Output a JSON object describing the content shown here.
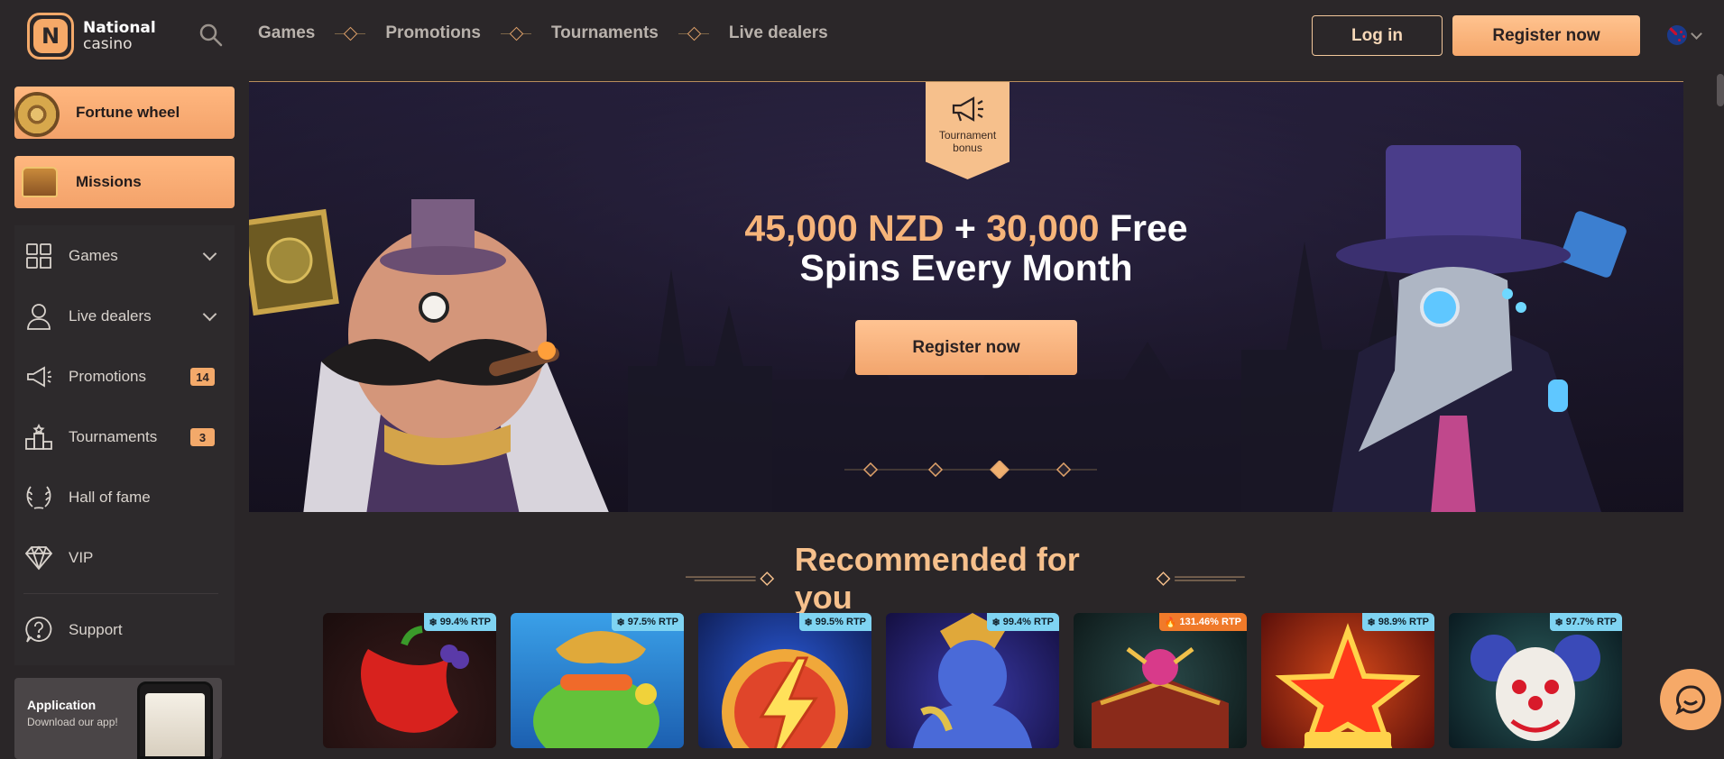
{
  "brand": {
    "name": "National",
    "sub": "casino",
    "initial": "N"
  },
  "topnav": {
    "items": [
      "Games",
      "Promotions",
      "Tournaments",
      "Live dealers"
    ],
    "login": "Log in",
    "register": "Register now"
  },
  "sidebar": {
    "promo": [
      "Fortune wheel",
      "Missions"
    ],
    "items": [
      {
        "label": "Games"
      },
      {
        "label": "Live dealers"
      },
      {
        "label": "Promotions",
        "badge": "14"
      },
      {
        "label": "Tournaments",
        "badge": "3"
      },
      {
        "label": "Hall of fame"
      },
      {
        "label": "VIP"
      },
      {
        "label": "Support"
      }
    ],
    "app": {
      "title": "Application",
      "subtitle": "Download our app!"
    }
  },
  "hero": {
    "tag": "Tournament bonus",
    "line1_a": "45,000 NZD",
    "line1_b": " + ",
    "line1_c": "30,000",
    "line1_d": " Free",
    "line2": "Spins Every Month",
    "cta": "Register now"
  },
  "recommended": {
    "title": "Recommended for you",
    "games": [
      {
        "rtp": "99.4% RTP",
        "hot": false
      },
      {
        "rtp": "97.5% RTP",
        "hot": false
      },
      {
        "rtp": "99.5% RTP",
        "hot": false
      },
      {
        "rtp": "99.4% RTP",
        "hot": false
      },
      {
        "rtp": "131.46% RTP",
        "hot": true
      },
      {
        "rtp": "98.9% RTP",
        "hot": false
      },
      {
        "rtp": "97.7% RTP",
        "hot": false
      }
    ]
  },
  "colors": {
    "accent": "#f6a968",
    "bg": "#2a2628",
    "gold": "#f6c08c"
  }
}
